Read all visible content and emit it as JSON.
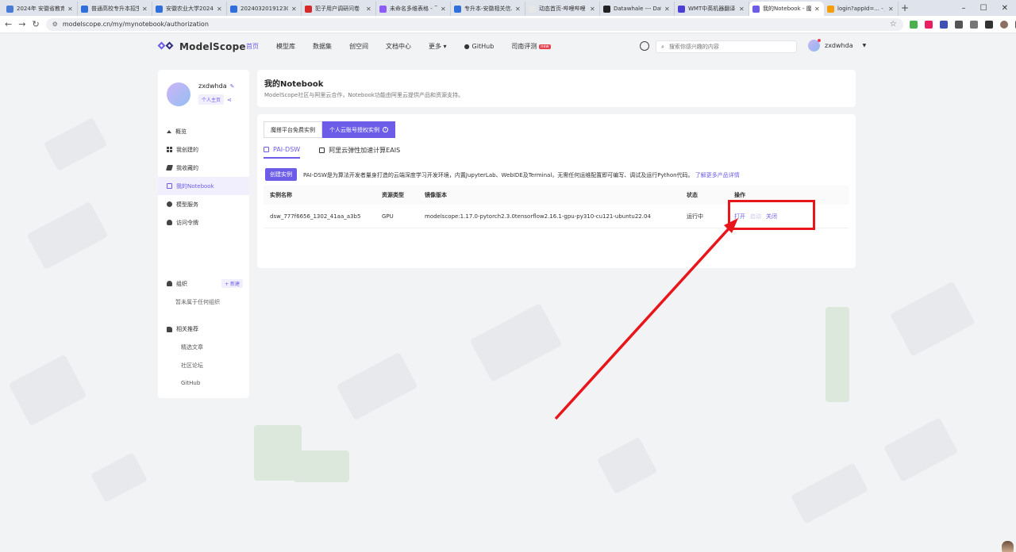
{
  "browser": {
    "tabs": [
      {
        "label": "2024年 安徽省教育招...",
        "active": false,
        "color": "#4a7bd6"
      },
      {
        "label": "普通高校专升本招生...",
        "active": false,
        "color": "#2f6fdb"
      },
      {
        "label": "安徽农业大学2024年...",
        "active": false,
        "color": "#2f6fdb"
      },
      {
        "label": "20240320191230 2...",
        "active": false,
        "color": "#2f6fdb"
      },
      {
        "label": "犯子用户调研问卷",
        "active": false,
        "color": "#d62a2a"
      },
      {
        "label": "未命名多维表格 - 飞书",
        "active": false,
        "color": "#8b5cf6"
      },
      {
        "label": "专升本-安徽相关信...",
        "active": false,
        "color": "#2f6fdb"
      },
      {
        "label": "动态首页-哔哩哔哩",
        "active": false,
        "color": "#e6e6e6"
      },
      {
        "label": "Datawhale --- Data...",
        "active": false,
        "color": "#222222"
      },
      {
        "label": "WMT中英机器翻译...",
        "active": false,
        "color": "#4b3fd6"
      },
      {
        "label": "我的Notebook - 魔搭...",
        "active": true,
        "color": "#6c5ce7"
      },
      {
        "label": "login?appId=... - Jup...",
        "active": false,
        "color": "#f59e0b"
      }
    ],
    "url": "modelscope.cn/my/mynotebook/authorization"
  },
  "header": {
    "logo_text": "ModelScope",
    "nav": [
      {
        "label": "首页",
        "active": true
      },
      {
        "label": "模型库",
        "active": false
      },
      {
        "label": "数据集",
        "active": false
      },
      {
        "label": "创空间",
        "active": false
      },
      {
        "label": "文档中心",
        "active": false
      },
      {
        "label": "更多 ▾",
        "active": false
      },
      {
        "label": "GitHub",
        "active": false
      },
      {
        "label": "司南评测",
        "active": false,
        "badge": "new"
      }
    ],
    "search_placeholder": "搜索你感兴趣的内容",
    "username": "zxdwhda"
  },
  "sidebar": {
    "username": "zxdwhda",
    "home_label": "个人主页",
    "items": [
      {
        "label": "概览",
        "icon": "home-icon",
        "active": false
      },
      {
        "label": "我创建的",
        "icon": "grid-icon",
        "active": false
      },
      {
        "label": "我收藏的",
        "icon": "favorite-icon",
        "active": false
      },
      {
        "label": "我的Notebook",
        "icon": "notebook-icon",
        "active": true
      },
      {
        "label": "模型服务",
        "icon": "model-service-icon",
        "active": false
      },
      {
        "label": "访问令牌",
        "icon": "token-icon",
        "active": false
      }
    ],
    "org_label": "组织",
    "org_new_label": "+ 新建",
    "org_empty": "暂未属于任何组织",
    "rec_label": "相关推荐",
    "rec_links": [
      "精选文章",
      "社区论坛",
      "GitHub"
    ]
  },
  "main": {
    "title": "我的Notebook",
    "subtitle": "ModelScope社区与阿里云合作，Notebook功能由阿里云提供产品和资源支持。",
    "segments": [
      "魔搭平台免费实例",
      "个人云账号授权实例"
    ],
    "subtabs": [
      "PAI-DSW",
      "阿里云弹性加速计算EAIS"
    ],
    "create_label": "创建实例",
    "desc_text": "PAI-DSW是为算法开发者量身打造的云端深度学习开发环境，内置JupyterLab、WebIDE及Terminal，无需任何运维配置即可编写、调试及运行Python代码。",
    "desc_link": "了解更多产品详情",
    "table": {
      "headers": [
        "实例名称",
        "资源类型",
        "镜像版本",
        "状态",
        "操作"
      ],
      "rows": [
        {
          "name": "dsw_777f6656_1302_41aa_a3b5",
          "type": "GPU",
          "image": "modelscope:1.17.0-pytorch2.3.0tensorflow2.16.1-gpu-py310-cu121-ubuntu22.04",
          "status": "运行中",
          "ops": [
            "打开",
            "启动",
            "关闭"
          ]
        }
      ]
    }
  },
  "colors": {
    "accent": "#6c5ce7",
    "annotation": "#e8161b"
  }
}
